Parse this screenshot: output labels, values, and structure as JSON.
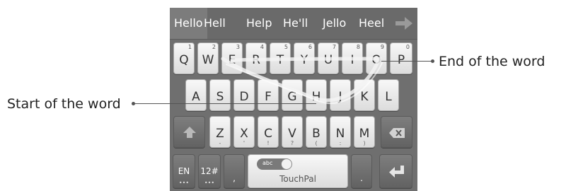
{
  "suggestions": [
    "Hello",
    "Hell",
    "Help",
    "He'll",
    "Jello",
    "Heel"
  ],
  "keyboard": {
    "row1": [
      {
        "label": "Q",
        "hint": "1"
      },
      {
        "label": "W",
        "hint": "2"
      },
      {
        "label": "E",
        "hint": "3"
      },
      {
        "label": "R",
        "hint": "4"
      },
      {
        "label": "T",
        "hint": "5"
      },
      {
        "label": "Y",
        "hint": "6"
      },
      {
        "label": "U",
        "hint": "7"
      },
      {
        "label": "I",
        "hint": "8"
      },
      {
        "label": "O",
        "hint": "9"
      },
      {
        "label": "P",
        "hint": "0"
      }
    ],
    "row2": [
      "A",
      "S",
      "D",
      "F",
      "G",
      "H",
      "J",
      "K",
      "L"
    ],
    "row3": [
      {
        "label": "Z",
        "sub": "-"
      },
      {
        "label": "X",
        "sub": "'"
      },
      {
        "label": "C",
        "sub": "!"
      },
      {
        "label": "V",
        "sub": "?"
      },
      {
        "label": "B",
        "sub": "("
      },
      {
        "label": "N",
        "sub": ":"
      },
      {
        "label": "M",
        "sub": ")"
      }
    ],
    "lang_key": "EN",
    "symbols_key": "12#",
    "key_dots": "•••",
    "comma_key": ",",
    "toggle_label": "abc",
    "space_label": "TouchPal",
    "period_key": "."
  },
  "callouts": {
    "end": "End of the word",
    "start": "Start of the word"
  },
  "icons": {
    "next": "arrow-right-icon",
    "shift": "shift-arrow-icon",
    "backspace": "backspace-icon",
    "enter": "enter-icon"
  }
}
